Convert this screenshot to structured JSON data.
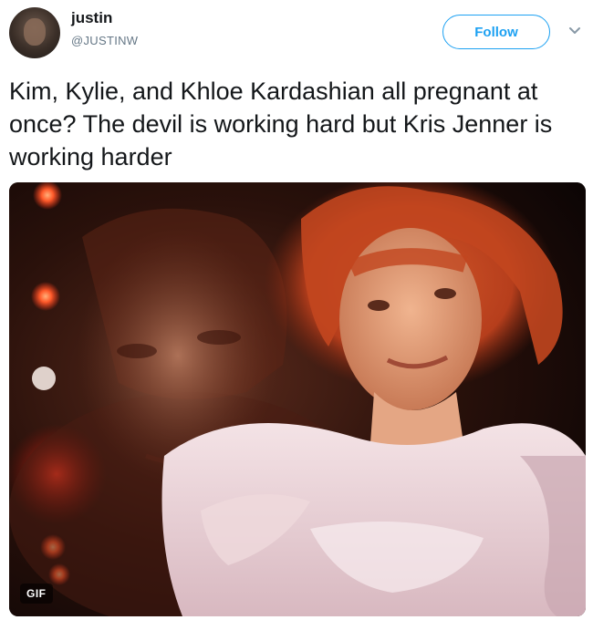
{
  "user": {
    "display_name": "justin",
    "handle": "@JUSTINW",
    "avatar_icon": "avatar"
  },
  "follow_button": {
    "label": "Follow",
    "color": "#1da1f2"
  },
  "menu": {
    "icon": "chevron-down-icon"
  },
  "tweet": {
    "text": "Kim, Kylie, and Khloe Kardashian all pregnant at once? The devil is working hard but Kris Jenner is working harder"
  },
  "media": {
    "badge": "GIF"
  }
}
